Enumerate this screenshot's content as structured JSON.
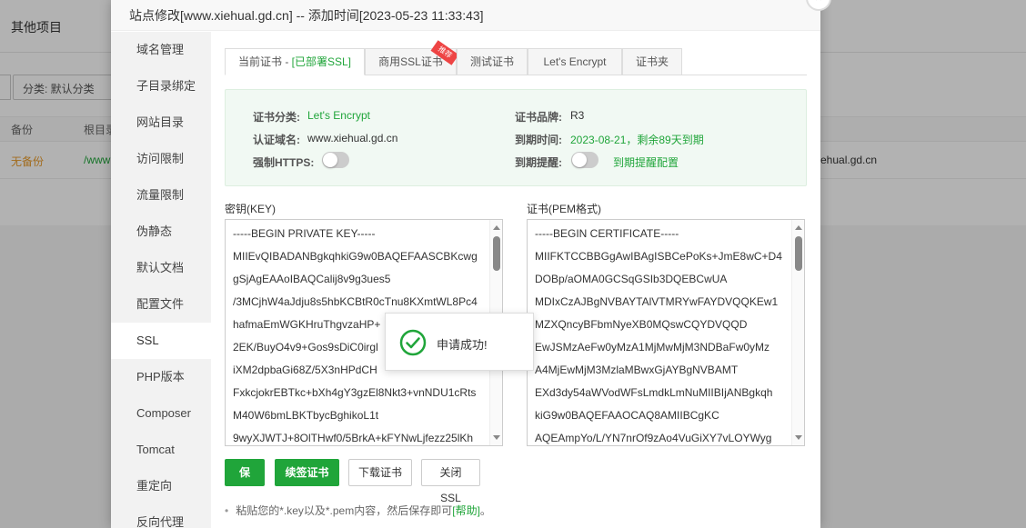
{
  "background": {
    "top_title": "其他项目",
    "category_select": "分类: 默认分类",
    "table_headers": [
      "备份",
      "根目录"
    ],
    "row": {
      "backup": "无备份",
      "path": "/www",
      "domain": "ehual.gd.cn"
    }
  },
  "dialog": {
    "title": "站点修改[www.xiehual.gd.cn] -- 添加时间[2023-05-23 11:33:43]",
    "close_label": "×"
  },
  "sidebar": {
    "items": [
      {
        "label": "域名管理"
      },
      {
        "label": "子目录绑定"
      },
      {
        "label": "网站目录"
      },
      {
        "label": "访问限制"
      },
      {
        "label": "流量限制"
      },
      {
        "label": "伪静态"
      },
      {
        "label": "默认文档"
      },
      {
        "label": "配置文件"
      },
      {
        "label": "SSL"
      },
      {
        "label": "PHP版本"
      },
      {
        "label": "Composer"
      },
      {
        "label": "Tomcat"
      },
      {
        "label": "重定向"
      },
      {
        "label": "反向代理"
      }
    ]
  },
  "tabs": {
    "current_prefix": "当前证书 - ",
    "current_status": "[已部署SSL]",
    "commercial": "商用SSL证书",
    "commercial_badge": "推荐",
    "test": "测试证书",
    "letsencrypt": "Let's Encrypt",
    "folder": "证书夹"
  },
  "info": {
    "category_label": "证书分类:",
    "category_value": "Let's Encrypt",
    "brand_label": "证书品牌:",
    "brand_value": "R3",
    "domain_label": "认证域名:",
    "domain_value": "www.xiehual.gd.cn",
    "expire_label": "到期时间:",
    "expire_value": "2023-08-21，剩余89天到期",
    "https_label": "强制HTTPS:",
    "remind_label": "到期提醒:",
    "remind_link": "到期提醒配置"
  },
  "key": {
    "label": "密钥(KEY)",
    "lines": [
      "-----BEGIN PRIVATE KEY-----",
      "MIIEvQIBADANBgkqhkiG9w0BAQEFAASCBKcwg",
      "gSjAgEAAoIBAQCalij8v9g3ues5",
      "/3MCjhW4aJdju8s5hbKCBtR0cTnu8KXmtWL8Pc4",
      "hafmaEmWGKHruThgvzaHP+",
      "2EK/BuyO4v9+Gos9sDiC0irgl",
      "iXM2dpbaGi68Z/5X3nHPdCH",
      "FxkcjokrEBTkc+bXh4gY3gzEl8Nkt3+vnNDU1cRts",
      "M40W6bmLBKTbycBghikoL1t",
      "9wyXJWTJ+8OlTHwf0/5BrkA+kFYNwLjfezz25lKh"
    ]
  },
  "cert": {
    "label": "证书(PEM格式)",
    "lines": [
      "-----BEGIN CERTIFICATE-----",
      "MIIFKTCCBBGgAwIBAgISBCePoKs+JmE8wC+D4",
      "DOBp/aOMA0GCSqGSIb3DQEBCwUA",
      "MDIxCzAJBgNVBAYTAlVTMRYwFAYDVQQKEw1",
      "MZXQncyBFbmNyeXB0MQswCQYDVQQD",
      "EwJSMzAeFw0yMzA1MjMwMjM3NDBaFw0yMz",
      "A4MjEwMjM3MzlaMBwxGjAYBgNVBAMT",
      "EXd3dy54aWVodWFsLmdkLmNuMIIBIjANBgkqh",
      "kiG9w0BAQEFAAOCAQ8AMIIBCgKC",
      "AQEAmpYo/L/YN7nrOf9zAo4VuGiXY7vLOYWyg"
    ]
  },
  "buttons": {
    "save": "保存",
    "renew": "续签证书",
    "download": "下载证书",
    "close_ssl": "关闭SSL"
  },
  "tip": {
    "text": "粘贴您的*.key以及*.pem内容，然后保存即可",
    "link": "[帮助]",
    "suffix": "。"
  },
  "toast": {
    "message": "申请成功!"
  },
  "colors": {
    "accent": "#20a53a",
    "badge": "#e44444"
  }
}
